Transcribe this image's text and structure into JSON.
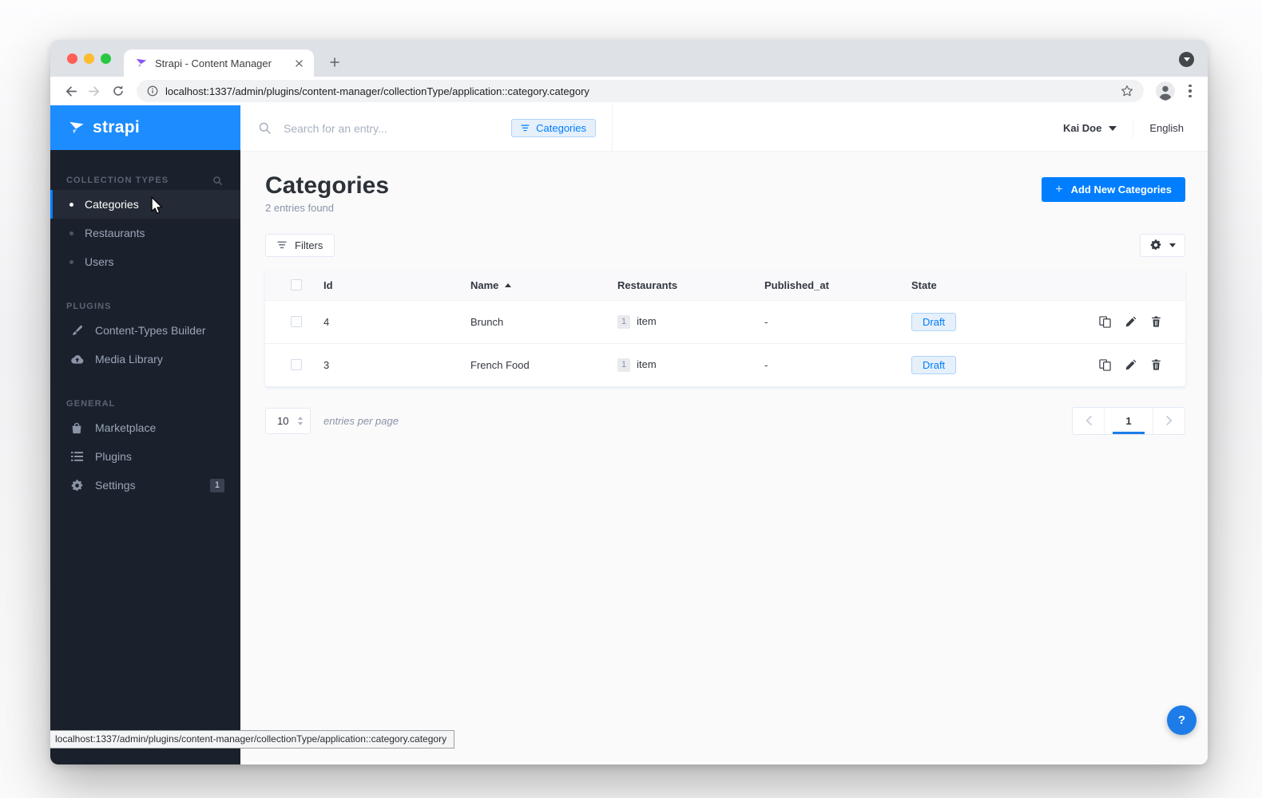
{
  "browser": {
    "tab_title": "Strapi - Content Manager",
    "url": "localhost:1337/admin/plugins/content-manager/collectionType/application::category.category",
    "status_url": "localhost:1337/admin/plugins/content-manager/collectionType/application::category.category"
  },
  "sidebar": {
    "logo_text": "strapi",
    "sections": [
      {
        "label": "COLLECTION TYPES",
        "items": [
          {
            "label": "Categories",
            "active": true
          },
          {
            "label": "Restaurants",
            "active": false
          },
          {
            "label": "Users",
            "active": false
          }
        ]
      },
      {
        "label": "PLUGINS",
        "items": [
          {
            "label": "Content-Types Builder",
            "icon": "brush-icon"
          },
          {
            "label": "Media Library",
            "icon": "cloud-upload-icon"
          }
        ]
      },
      {
        "label": "GENERAL",
        "items": [
          {
            "label": "Marketplace",
            "icon": "bag-icon"
          },
          {
            "label": "Plugins",
            "icon": "list-icon"
          },
          {
            "label": "Settings",
            "icon": "gear-icon",
            "badge": "1"
          }
        ]
      }
    ]
  },
  "topbar": {
    "search_placeholder": "Search for an entry...",
    "filter_chip": "Categories",
    "user_name": "Kai Doe",
    "language": "English"
  },
  "content": {
    "title": "Categories",
    "subtitle": "2 entries found",
    "add_icon": "+",
    "add_button": "Add New Categories",
    "filters_button": "Filters",
    "table": {
      "columns": [
        "Id",
        "Name",
        "Restaurants",
        "Published_at",
        "State"
      ],
      "sorted_column": "Name",
      "sort_direction": "asc",
      "rows": [
        {
          "id": "4",
          "name": "Brunch",
          "restaurants_count": "1",
          "restaurants_label": "item",
          "published_at": "-",
          "state": "Draft"
        },
        {
          "id": "3",
          "name": "French Food",
          "restaurants_count": "1",
          "restaurants_label": "item",
          "published_at": "-",
          "state": "Draft"
        }
      ]
    },
    "pagination": {
      "per_page": "10",
      "per_page_label": "entries per page",
      "current_page": "1"
    }
  },
  "help": {
    "label": "?"
  },
  "colors": {
    "accent_blue": "#007eff",
    "logo_header_blue": "#1c8cff",
    "sidebar_bg": "#1b212c",
    "page_bg": "#fafafb",
    "draft_chip_bg": "#e6f0fb",
    "draft_chip_border": "#aed4fb",
    "card_border": "#e3e9f3"
  }
}
